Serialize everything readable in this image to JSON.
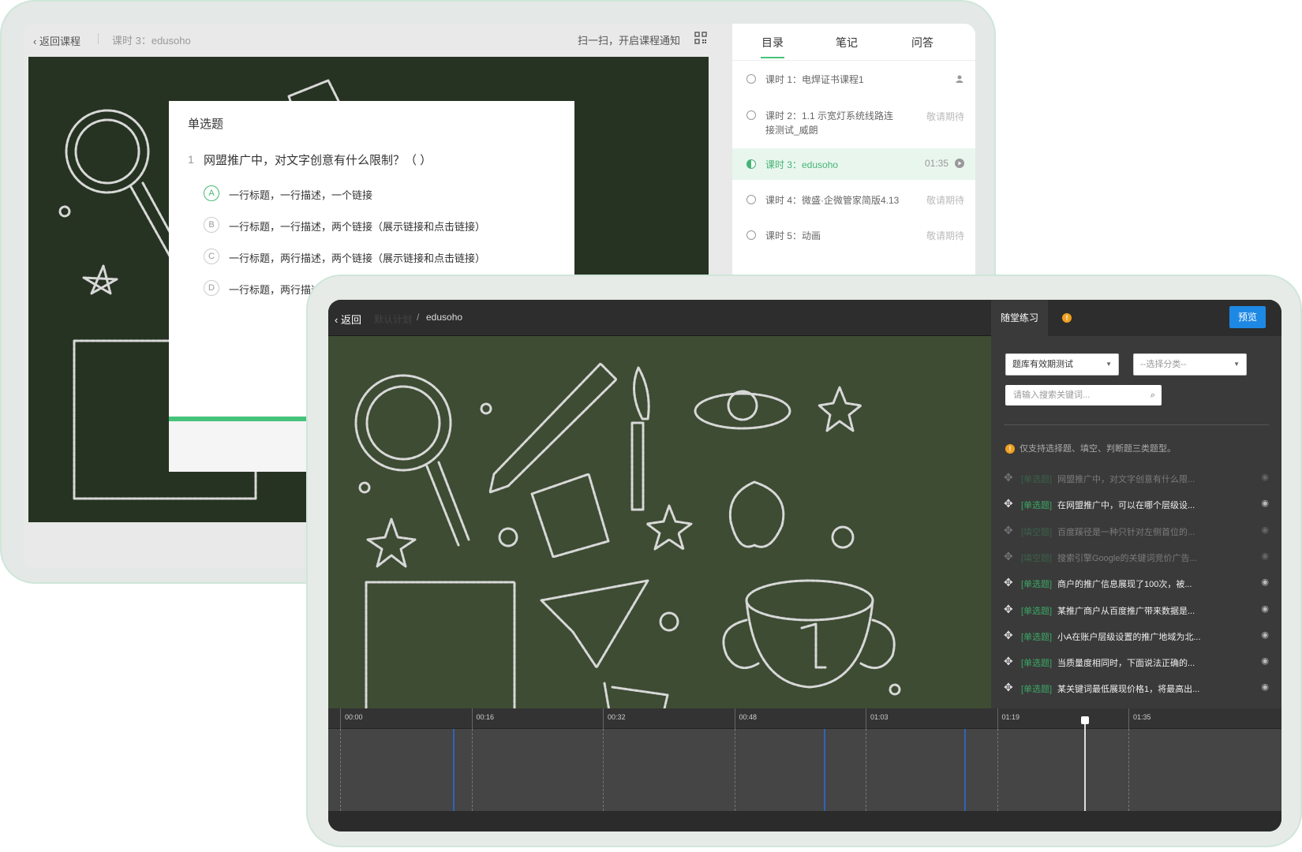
{
  "back_player": {
    "back_label": "返回课程",
    "lesson_title": "课时 3：edusoho",
    "notify_text": "扫一扫，开启课程通知",
    "quiz": {
      "type_label": "单选题",
      "question_number": "1",
      "question_text": "网盟推广中，对文字创意有什么限制？（ ）",
      "options": [
        {
          "letter": "A",
          "text": "一行标题，一行描述，一个链接"
        },
        {
          "letter": "B",
          "text": "一行标题，一行描述，两个链接（展示链接和点击链接）"
        },
        {
          "letter": "C",
          "text": "一行标题，两行描述，两个链接（展示链接和点击链接）"
        },
        {
          "letter": "D",
          "text": "一行标题，两行描述"
        }
      ]
    },
    "sidebar": {
      "tabs": [
        "目录",
        "笔记",
        "问答"
      ],
      "lessons": [
        {
          "title": "课时 1：电焊证书课程1",
          "right": ""
        },
        {
          "title": "课时 2：1.1 示宽灯系统线路连接测试_威朗",
          "right": "敬请期待"
        },
        {
          "title": "课时 3：edusoho",
          "right": "01:35"
        },
        {
          "title": "课时 4：微盛·企微管家简版4.13",
          "right": "敬请期待"
        },
        {
          "title": "课时 5：动画",
          "right": "敬请期待"
        }
      ]
    }
  },
  "front_editor": {
    "back_label": "返回",
    "plan_label": "默认计划",
    "crumb_sep": "/",
    "course_name": "edusoho",
    "panel": {
      "tab_label": "随堂练习",
      "info_icon": "!",
      "preview_label": "预览",
      "bank_select": "题库有效期测试",
      "category_select": "--选择分类--",
      "search_placeholder": "请输入搜索关键词...",
      "hint": "仅支持选择题、填空、判断题三类题型。",
      "questions": [
        {
          "tag": "[单选题]",
          "text": "网盟推广中，对文字创意有什么限...",
          "dim": true
        },
        {
          "tag": "[单选题]",
          "text": "在网盟推广中，可以在哪个层级设...",
          "dim": false
        },
        {
          "tag": "[填空题]",
          "text": "百度蹊径是一种只针对左侧首位的...",
          "dim": true
        },
        {
          "tag": "[填空题]",
          "text": "搜索引擎Google的关键词竞价广告...",
          "dim": true
        },
        {
          "tag": "[单选题]",
          "text": "商户的推广信息展现了100次，被...",
          "dim": false
        },
        {
          "tag": "[单选题]",
          "text": "某推广商户从百度推广带来数据是...",
          "dim": false
        },
        {
          "tag": "[单选题]",
          "text": "小A在账户层级设置的推广地域为北...",
          "dim": false
        },
        {
          "tag": "[单选题]",
          "text": "当质量度相同时，下面说法正确的...",
          "dim": false
        },
        {
          "tag": "[单选题]",
          "text": "某关键词最低展现价格1，将最高出...",
          "dim": false
        }
      ]
    },
    "timeline": {
      "ticks": [
        "00:00",
        "00:16",
        "00:32",
        "00:48",
        "01:03",
        "01:19",
        "01:35"
      ]
    }
  },
  "icons": [
    "chevron-left-icon",
    "qr-code-icon",
    "radio-icon",
    "lock-person-icon",
    "play-icon",
    "move-icon",
    "eye-icon",
    "search-icon",
    "info-icon"
  ],
  "colors": {
    "accent_green": "#46c37b",
    "primary_blue": "#1e88e5",
    "warning_orange": "#f0a020"
  }
}
